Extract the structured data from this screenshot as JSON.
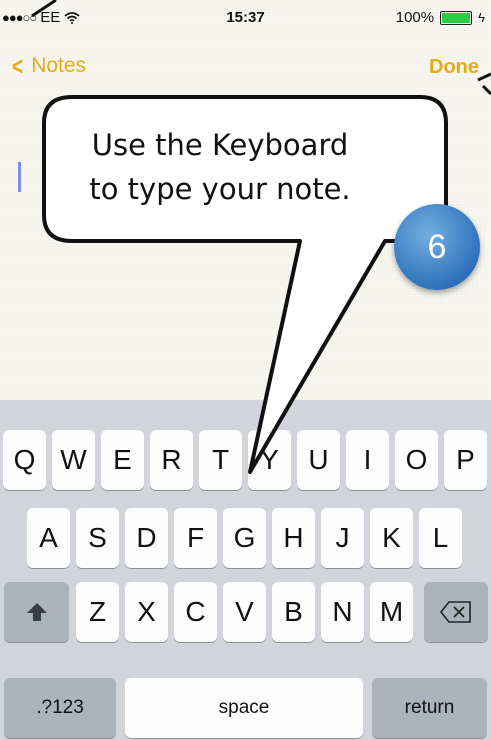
{
  "status_bar": {
    "signal_dots": "●●●○○",
    "carrier": "EE",
    "wifi_icon": "wifi-icon",
    "time": "15:37",
    "battery_percent": "100%",
    "battery_level": 1.0,
    "charging_icon": "bolt-icon"
  },
  "nav": {
    "back_label": "Notes",
    "back_icon": "chevron-left-icon",
    "done_label": "Done"
  },
  "callout": {
    "text_line1": "Use the Keyboard",
    "text_line2": "to type your note.",
    "step_number": "6"
  },
  "keyboard": {
    "row1": [
      "Q",
      "W",
      "E",
      "R",
      "T",
      "Y",
      "U",
      "I",
      "O",
      "P"
    ],
    "row2": [
      "A",
      "S",
      "D",
      "F",
      "G",
      "H",
      "J",
      "K",
      "L"
    ],
    "row3": [
      "Z",
      "X",
      "C",
      "V",
      "B",
      "N",
      "M"
    ],
    "shift_icon": "shift-icon",
    "delete_icon": "delete-icon",
    "numbers_label": ".?123",
    "space_label": "space",
    "return_label": "return"
  },
  "colors": {
    "accent": "#e4ad12",
    "keyboard_bg": "#d1d5db",
    "step_badge": "#2f73bd"
  }
}
